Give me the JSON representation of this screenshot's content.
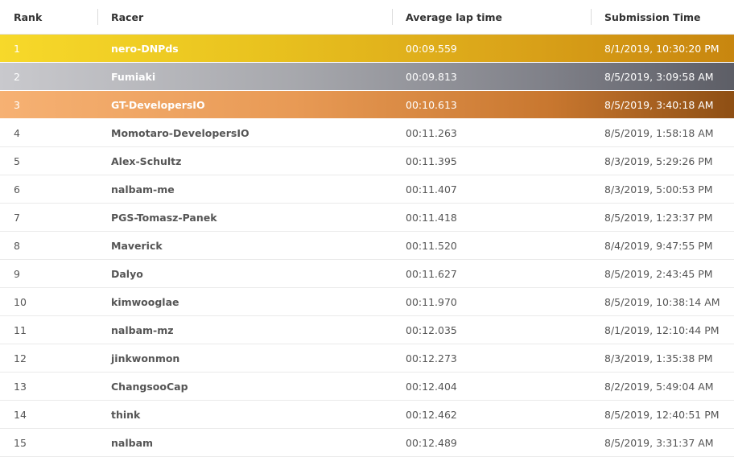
{
  "headers": {
    "rank": "Rank",
    "racer": "Racer",
    "avg_lap": "Average lap time",
    "submission": "Submission Time"
  },
  "colors": {
    "gold": "#e3b81f",
    "silver": "#9a9ba1",
    "bronze": "#e0924c"
  },
  "rows": [
    {
      "rank": "1",
      "racer": "nero-DNPds",
      "time": "00:09.559",
      "submitted": "8/1/2019, 10:30:20 PM"
    },
    {
      "rank": "2",
      "racer": "Fumiaki",
      "time": "00:09.813",
      "submitted": "8/5/2019, 3:09:58 AM"
    },
    {
      "rank": "3",
      "racer": "GT-DevelopersIO",
      "time": "00:10.613",
      "submitted": "8/5/2019, 3:40:18 AM"
    },
    {
      "rank": "4",
      "racer": "Momotaro-DevelopersIO",
      "time": "00:11.263",
      "submitted": "8/5/2019, 1:58:18 AM"
    },
    {
      "rank": "5",
      "racer": "Alex-Schultz",
      "time": "00:11.395",
      "submitted": "8/3/2019, 5:29:26 PM"
    },
    {
      "rank": "6",
      "racer": "nalbam-me",
      "time": "00:11.407",
      "submitted": "8/3/2019, 5:00:53 PM"
    },
    {
      "rank": "7",
      "racer": "PGS-Tomasz-Panek",
      "time": "00:11.418",
      "submitted": "8/5/2019, 1:23:37 PM"
    },
    {
      "rank": "8",
      "racer": "Maverick",
      "time": "00:11.520",
      "submitted": "8/4/2019, 9:47:55 PM"
    },
    {
      "rank": "9",
      "racer": "Dalyo",
      "time": "00:11.627",
      "submitted": "8/5/2019, 2:43:45 PM"
    },
    {
      "rank": "10",
      "racer": "kimwooglae",
      "time": "00:11.970",
      "submitted": "8/5/2019, 10:38:14 AM"
    },
    {
      "rank": "11",
      "racer": "nalbam-mz",
      "time": "00:12.035",
      "submitted": "8/1/2019, 12:10:44 PM"
    },
    {
      "rank": "12",
      "racer": "jinkwonmon",
      "time": "00:12.273",
      "submitted": "8/3/2019, 1:35:38 PM"
    },
    {
      "rank": "13",
      "racer": "ChangsooCap",
      "time": "00:12.404",
      "submitted": "8/2/2019, 5:49:04 AM"
    },
    {
      "rank": "14",
      "racer": "think",
      "time": "00:12.462",
      "submitted": "8/5/2019, 12:40:51 PM"
    },
    {
      "rank": "15",
      "racer": "nalbam",
      "time": "00:12.489",
      "submitted": "8/5/2019, 3:31:37 AM"
    }
  ]
}
